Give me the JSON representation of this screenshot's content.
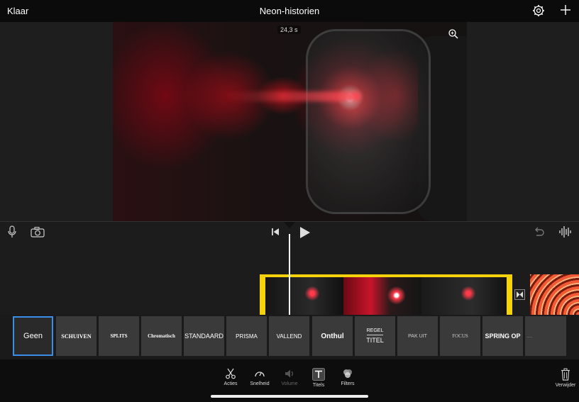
{
  "top_bar": {
    "done_label": "Klaar",
    "project_title": "Neon-historien"
  },
  "viewer": {
    "duration": "24,3 s"
  },
  "titles": [
    {
      "label": "Geen",
      "selected": true
    },
    {
      "label": "SCHUIVEN"
    },
    {
      "label": "SPLITS"
    },
    {
      "label": "Chromatisch"
    },
    {
      "label": "STANDAARD"
    },
    {
      "label": "PRISMA"
    },
    {
      "label": "VALLEND"
    },
    {
      "label": "Onthul"
    },
    {
      "label_top": "REGEL",
      "label_bottom": "TITEL"
    },
    {
      "label": "PAK UIT"
    },
    {
      "label": "FOCUS"
    },
    {
      "label": "SPRING OP"
    },
    {
      "label": "......"
    }
  ],
  "tools": [
    {
      "label": "Acties",
      "icon": "scissors-icon"
    },
    {
      "label": "Snelheid",
      "icon": "speedometer-icon"
    },
    {
      "label": "Volume",
      "icon": "speaker-icon",
      "disabled": true
    },
    {
      "label": "Titels",
      "icon": "title-T-icon",
      "active": true
    },
    {
      "label": "Filters",
      "icon": "filters-icon"
    }
  ],
  "delete_label": "Verwijder",
  "colors": {
    "accent": "#3b8ee8",
    "clip_border": "#f5d20b"
  }
}
